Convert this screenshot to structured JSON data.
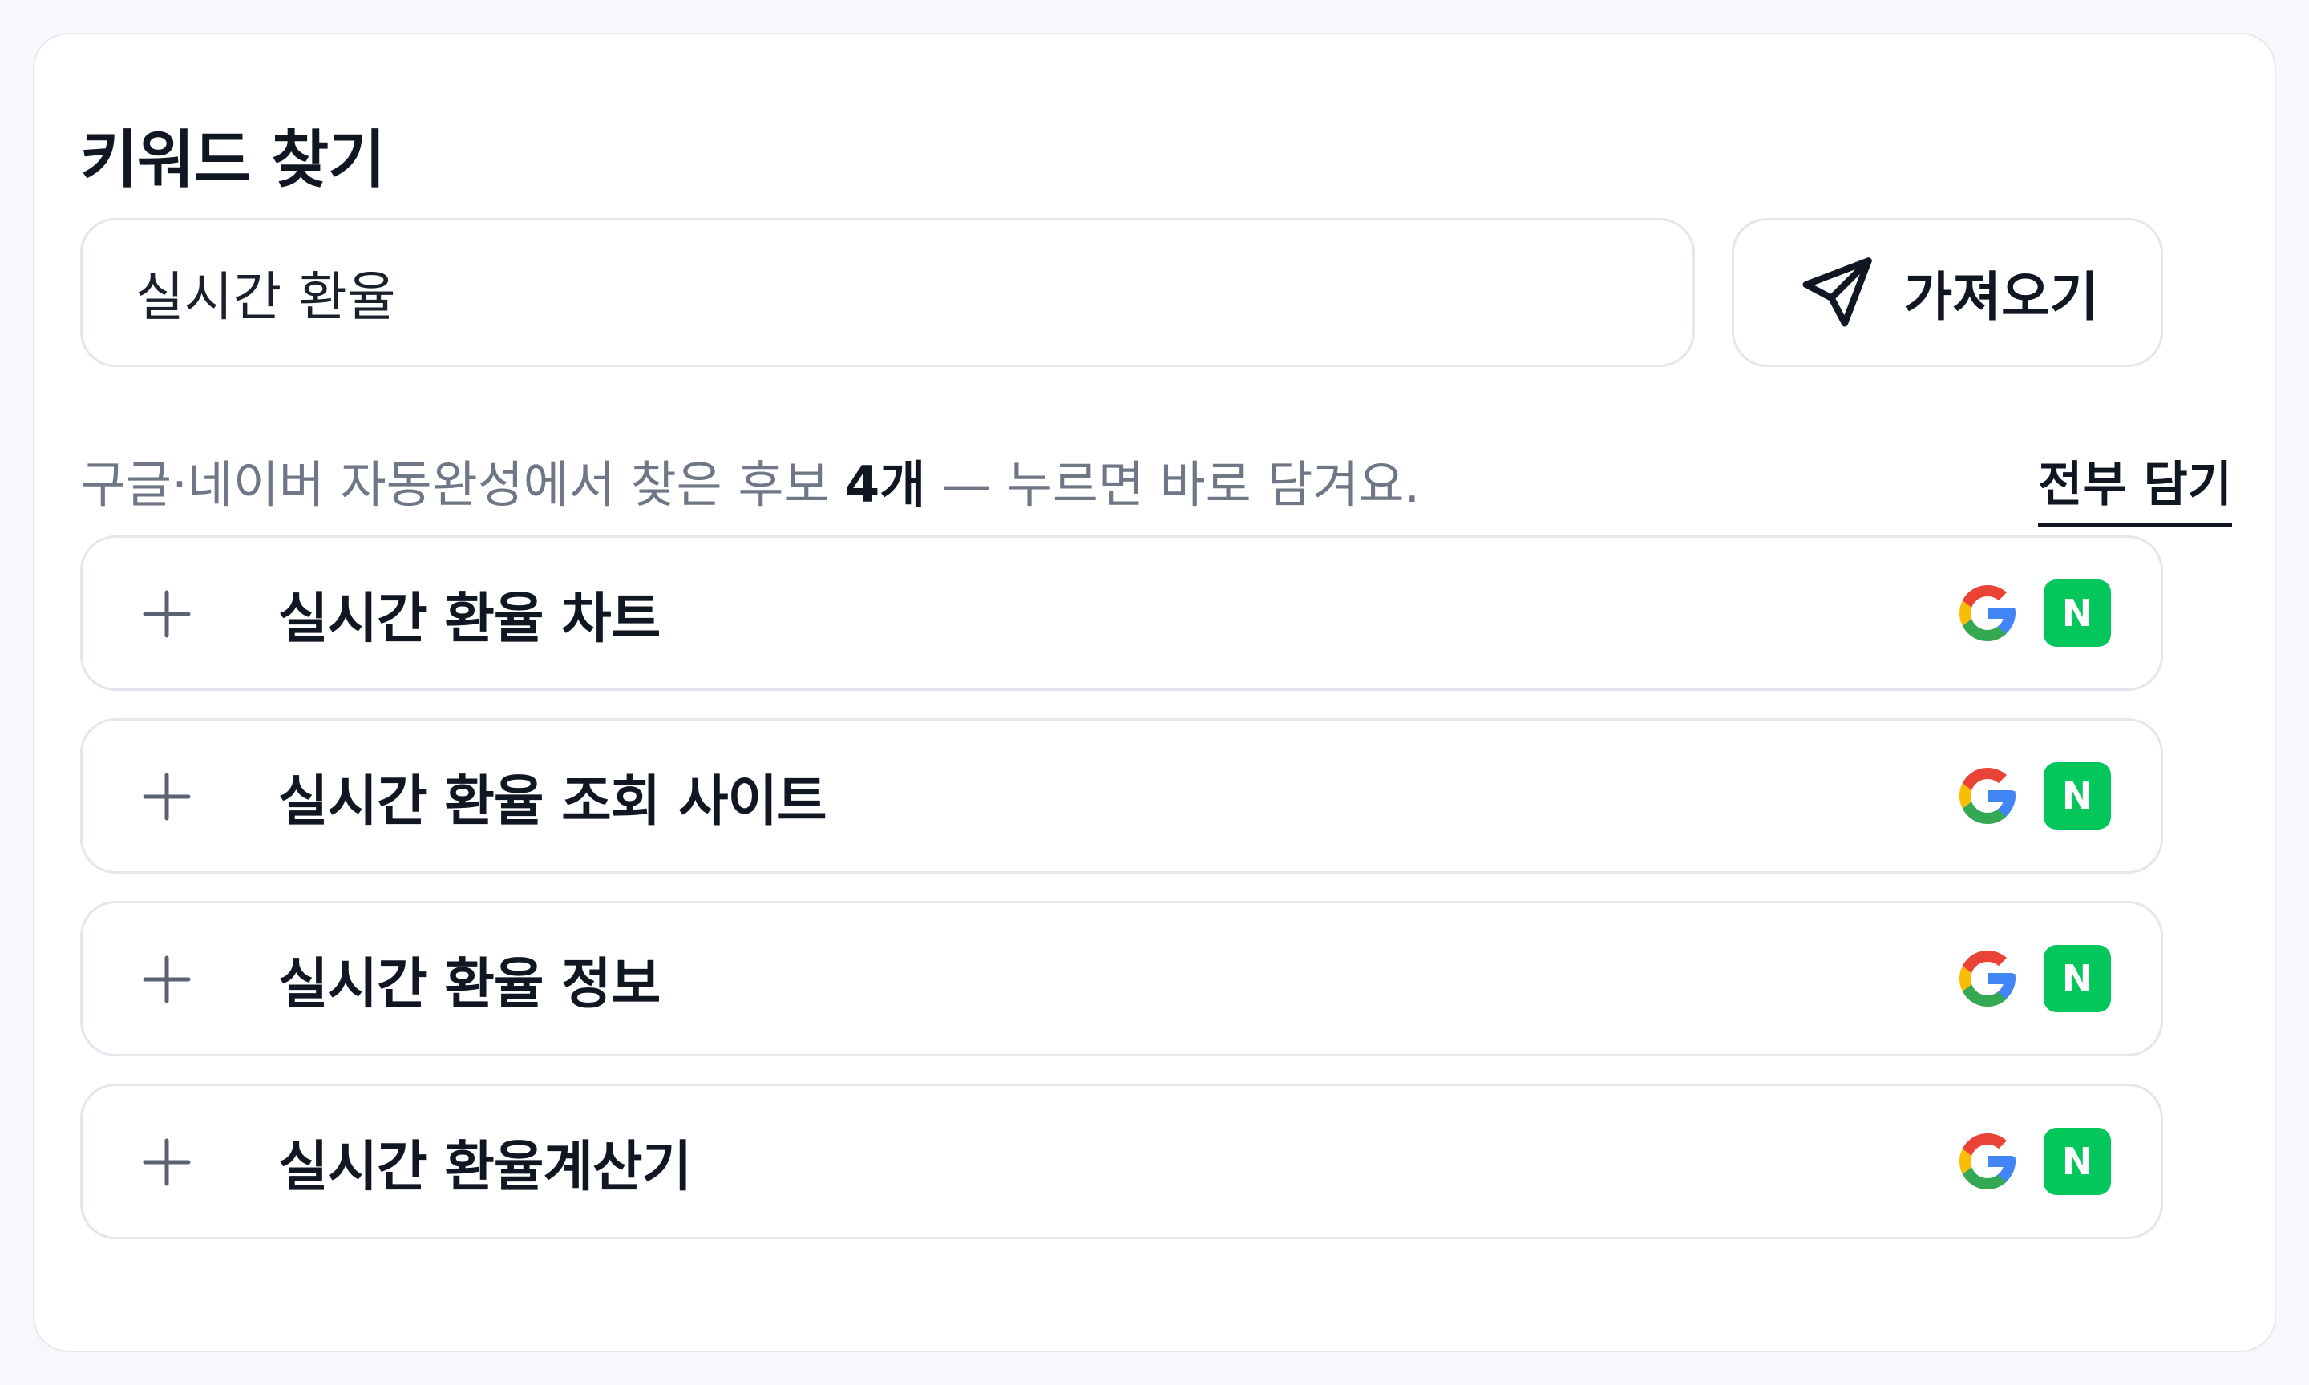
{
  "panel": {
    "title": "키워드 찾기"
  },
  "search": {
    "value": "실시간 환율",
    "button_label": "가져오기",
    "button_icon": "send-icon"
  },
  "hint": {
    "prefix": "구글·네이버 자동완성에서 찾은 후보 ",
    "count": "4개",
    "suffix": " — 누르면 바로 담겨요.",
    "add_all_label": "전부 담기"
  },
  "suggestions": [
    {
      "text": "실시간 환율 차트",
      "sources": [
        "google",
        "naver"
      ]
    },
    {
      "text": "실시간 환율 조회 사이트",
      "sources": [
        "google",
        "naver"
      ]
    },
    {
      "text": "실시간 환율 정보",
      "sources": [
        "google",
        "naver"
      ]
    },
    {
      "text": "실시간 환율계산기",
      "sources": [
        "google",
        "naver"
      ]
    }
  ],
  "badges": {
    "naver_letter": "N"
  },
  "colors": {
    "naver_green": "#03c75a",
    "google_blue": "#4285f4",
    "google_red": "#ea4335",
    "google_yellow": "#fbbc05",
    "google_green": "#34a853",
    "text_primary": "#111722",
    "text_muted": "#6f7685"
  }
}
